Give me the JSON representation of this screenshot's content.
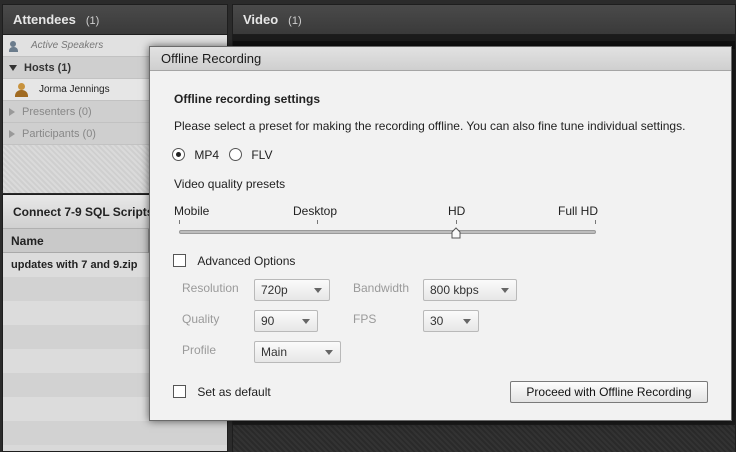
{
  "attendees": {
    "title": "Attendees",
    "count": "(1)",
    "active_speakers": "Active Speakers",
    "hosts": "Hosts (1)",
    "host_name": "Jorma Jennings",
    "presenters": "Presenters (0)",
    "participants": "Participants (0)"
  },
  "video": {
    "title": "Video",
    "count": "(1)"
  },
  "files": {
    "title": "Connect 7-9 SQL Scripts",
    "column_name": "Name",
    "file_name": "updates with 7 and 9.zip"
  },
  "dialog": {
    "title": "Offline Recording",
    "settings_heading": "Offline recording settings",
    "description": "Please select a preset for making the recording offline. You can also fine tune individual settings.",
    "format_options": [
      {
        "label": "MP4",
        "selected": true
      },
      {
        "label": "FLV",
        "selected": false
      }
    ],
    "presets_label": "Video quality presets",
    "presets": [
      "Mobile",
      "Desktop",
      "HD",
      "Full HD"
    ],
    "selected_preset": "HD",
    "advanced_label": "Advanced Options",
    "advanced_checked": false,
    "resolution_label": "Resolution",
    "resolution_value": "720p",
    "bandwidth_label": "Bandwidth",
    "bandwidth_value": "800 kbps",
    "quality_label": "Quality",
    "quality_value": "90",
    "fps_label": "FPS",
    "fps_value": "30",
    "profile_label": "Profile",
    "profile_value": "Main",
    "default_label": "Set as default",
    "default_checked": false,
    "proceed_button": "Proceed with Offline Recording"
  },
  "colors": {
    "dialog_bg": "#f2f2f2",
    "disabled_text": "#9a9a9a",
    "pane_dark": "#3a3a3a"
  }
}
